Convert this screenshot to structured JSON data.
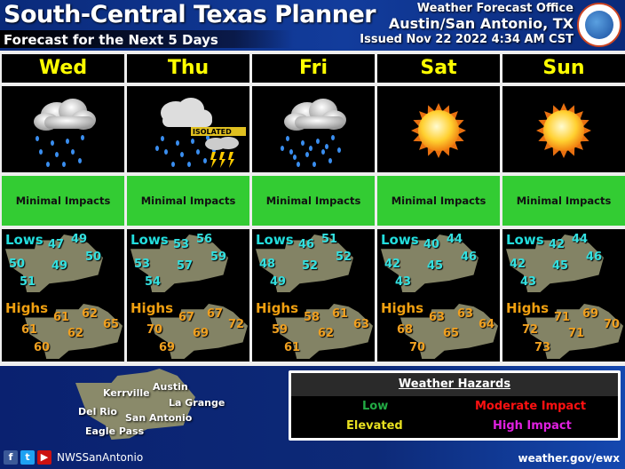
{
  "header": {
    "title": "South-Central Texas Planner",
    "subtitle": "Forecast for the Next 5 Days",
    "office_line1": "Weather Forecast Office",
    "office_line2": "Austin/San Antonio, TX",
    "issued": "Issued Nov 22 2022 4:34 AM CST",
    "logo": "nws-logo-icon"
  },
  "labels": {
    "lows": "Lows",
    "highs": "Highs"
  },
  "days": [
    {
      "name": "Wed",
      "icon": "rain-cloud-icon",
      "badge": "",
      "impact": "Minimal Impacts",
      "lows": [
        "47",
        "49",
        "50",
        "50",
        "49",
        "51"
      ],
      "highs": [
        "61",
        "62",
        "61",
        "65",
        "62",
        "60"
      ]
    },
    {
      "name": "Thu",
      "icon": "rain-isolated-thunderstorm-icon",
      "badge": "ISOLATED",
      "impact": "Minimal Impacts",
      "lows": [
        "53",
        "56",
        "53",
        "59",
        "57",
        "54"
      ],
      "highs": [
        "67",
        "67",
        "70",
        "72",
        "69",
        "69"
      ]
    },
    {
      "name": "Fri",
      "icon": "rain-cloud-icon",
      "badge": "",
      "impact": "Minimal Impacts",
      "lows": [
        "46",
        "51",
        "48",
        "52",
        "52",
        "49"
      ],
      "highs": [
        "58",
        "61",
        "59",
        "63",
        "62",
        "61"
      ]
    },
    {
      "name": "Sat",
      "icon": "sunny-icon",
      "badge": "",
      "impact": "Minimal Impacts",
      "lows": [
        "40",
        "44",
        "42",
        "46",
        "45",
        "43"
      ],
      "highs": [
        "63",
        "63",
        "68",
        "64",
        "65",
        "70"
      ]
    },
    {
      "name": "Sun",
      "icon": "sunny-icon",
      "badge": "",
      "impact": "Minimal Impacts",
      "lows": [
        "42",
        "44",
        "42",
        "46",
        "45",
        "43"
      ],
      "highs": [
        "71",
        "69",
        "72",
        "70",
        "71",
        "73"
      ]
    }
  ],
  "reference_map": {
    "cities": [
      "Kerrville",
      "Austin",
      "La Grange",
      "Del Rio",
      "San Antonio",
      "Eagle Pass"
    ]
  },
  "hazards": {
    "title": "Weather Hazards",
    "levels": [
      {
        "label": "Low",
        "color": "#22aa44"
      },
      {
        "label": "Moderate Impact",
        "color": "#ff1111"
      },
      {
        "label": "Elevated",
        "color": "#e8e020"
      },
      {
        "label": "High Impact",
        "color": "#e020e0"
      }
    ]
  },
  "footer": {
    "social": [
      "facebook-icon",
      "twitter-icon",
      "youtube-icon"
    ],
    "handle": "NWSSanAntonio",
    "url": "weather.gov/ewx"
  },
  "colors": {
    "impact_green": "#33cc33",
    "day_yellow": "#ffff00",
    "lows": "#33e0e0",
    "highs": "#f0a020"
  }
}
